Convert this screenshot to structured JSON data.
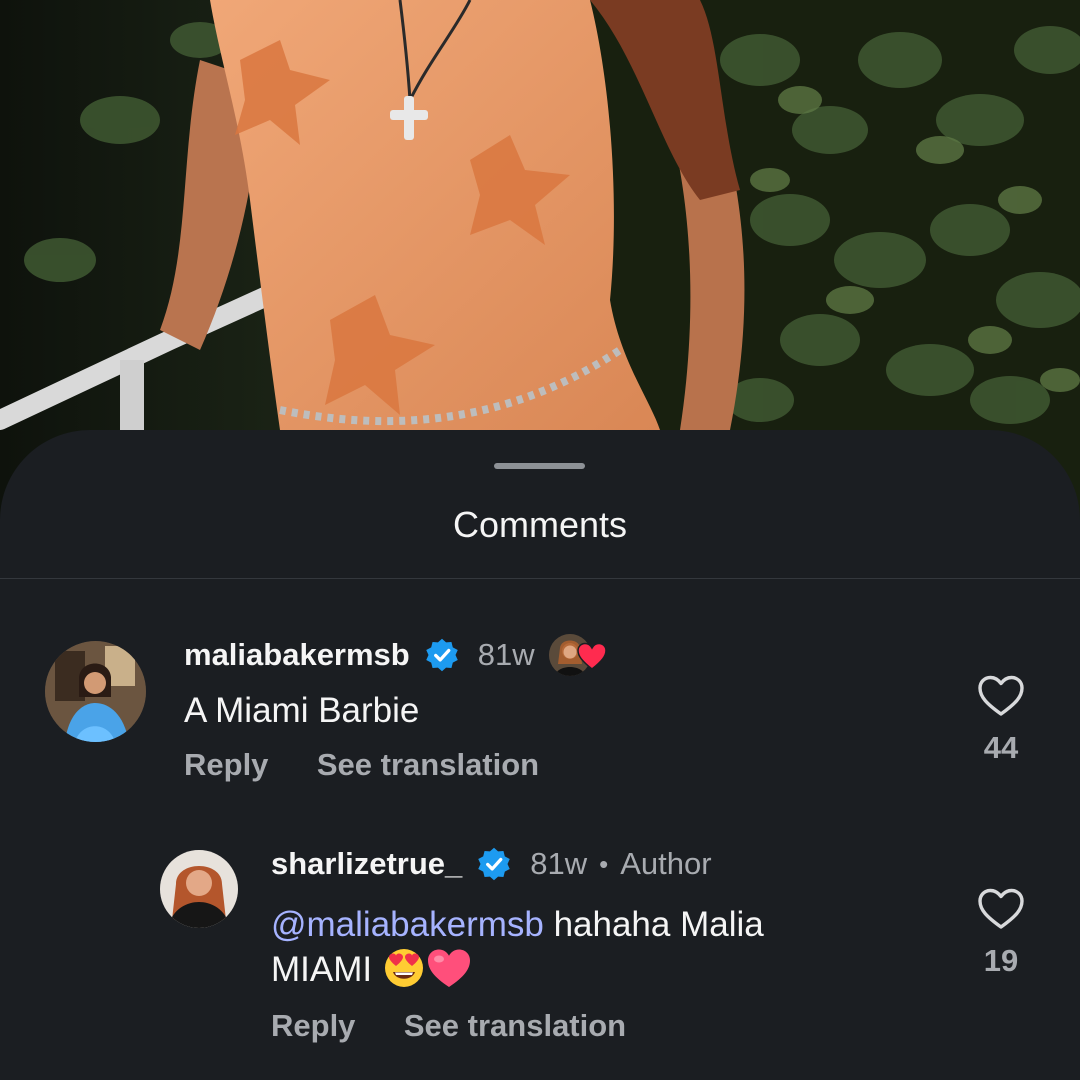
{
  "sheet": {
    "title": "Comments"
  },
  "comments": [
    {
      "username": "maliabakermsb",
      "verified": true,
      "time": "81w",
      "liked_by_author": true,
      "text": "A Miami Barbie",
      "reply_label": "Reply",
      "translate_label": "See translation",
      "like_count": "44"
    },
    {
      "username": "sharlizetrue_",
      "verified": true,
      "time": "81w",
      "separator": "•",
      "author_tag": "Author",
      "mention": "@maliabakermsb",
      "text_line1": " hahaha Malia",
      "text_line2": "MIAMI ",
      "emojis": [
        "heart-eyes-emoji",
        "pink-heart-emoji"
      ],
      "reply_label": "Reply",
      "translate_label": "See translation",
      "like_count": "19"
    }
  ],
  "colors": {
    "sheet_bg": "#1b1e22",
    "verified_blue": "#1d9bf0",
    "mention": "#a6b3ff",
    "muted_text": "#a8abb0",
    "heart_red": "#ff2b4f"
  }
}
